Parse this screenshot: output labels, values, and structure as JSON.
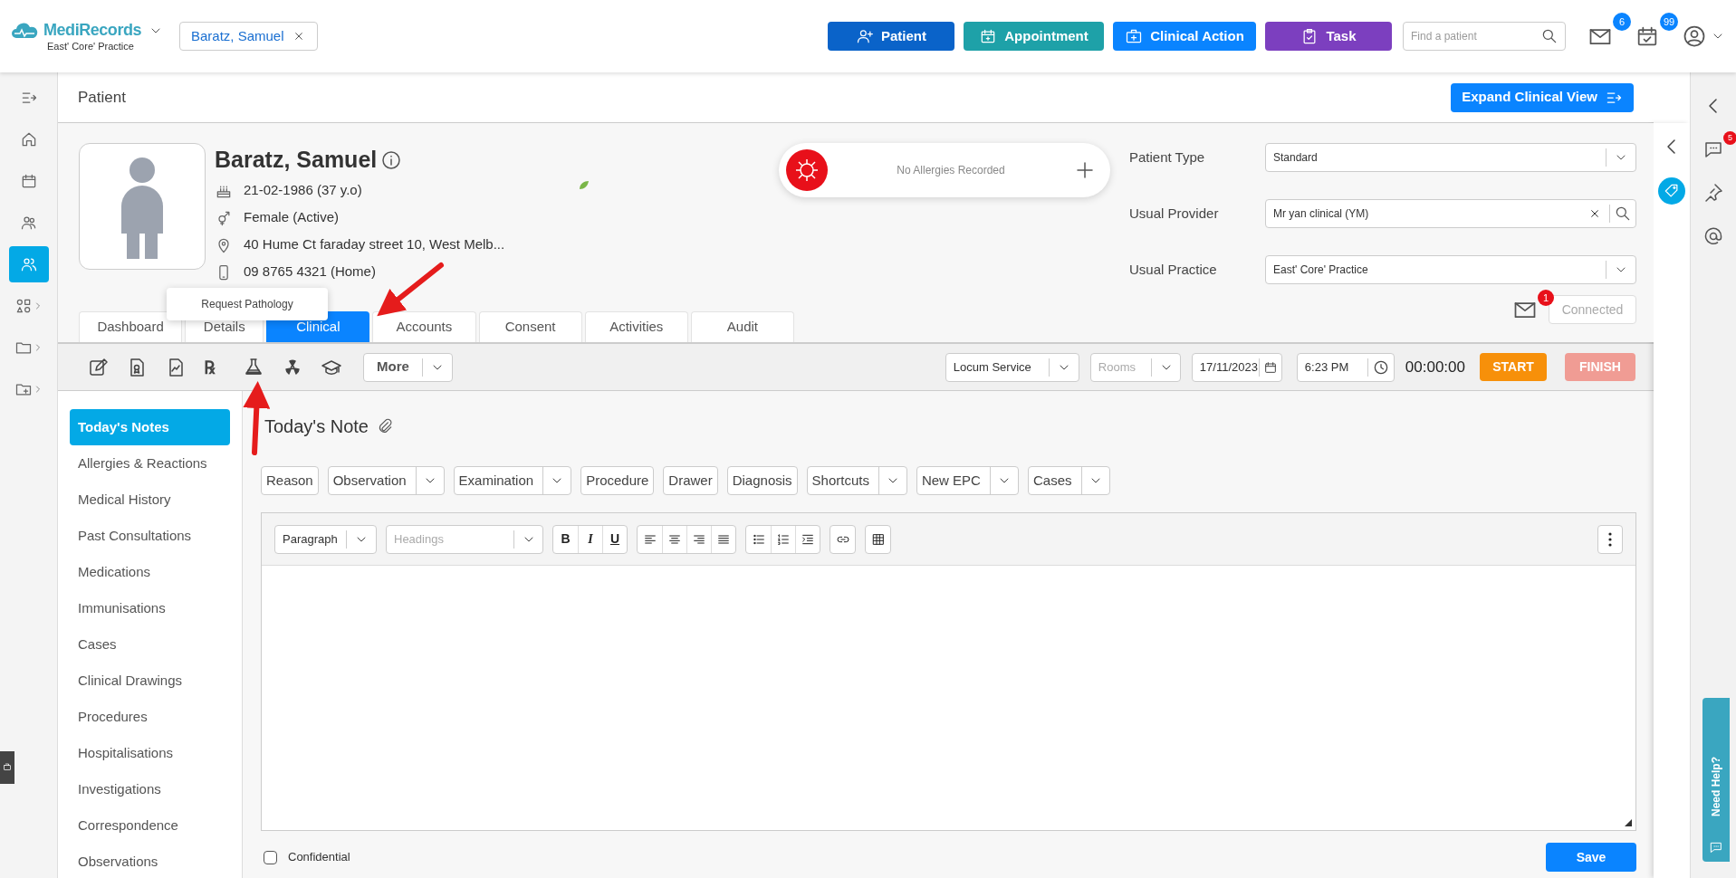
{
  "app": {
    "logo": "MediRecords",
    "practice": "East' Core' Practice"
  },
  "patient_chip": {
    "label": "Baratz, Samuel"
  },
  "action_buttons": [
    {
      "label": "Patient",
      "kind": "patient"
    },
    {
      "label": "Appointment",
      "kind": "appointment"
    },
    {
      "label": "Clinical Action",
      "kind": "clinical"
    },
    {
      "label": "Task",
      "kind": "task"
    }
  ],
  "search": {
    "placeholder": "Find a patient"
  },
  "notifications": [
    {
      "kind": "mail",
      "count": "6"
    },
    {
      "kind": "tasks",
      "count": "99"
    }
  ],
  "rail": [
    {
      "kind": "collapse",
      "selected": false,
      "submenu": false
    },
    {
      "kind": "home",
      "selected": false,
      "submenu": false
    },
    {
      "kind": "calendar",
      "selected": false,
      "submenu": false
    },
    {
      "kind": "people",
      "selected": false,
      "submenu": false
    },
    {
      "kind": "patient",
      "selected": true,
      "submenu": false
    },
    {
      "kind": "apps",
      "selected": false,
      "submenu": true
    },
    {
      "kind": "folder",
      "selected": false,
      "submenu": true
    },
    {
      "kind": "folder-add",
      "selected": false,
      "submenu": true
    }
  ],
  "page_title": "Patient",
  "expand_button": "Expand Clinical View",
  "patient": {
    "name": "Baratz, Samuel",
    "details": [
      {
        "kind": "dob",
        "text": "21-02-1986 (37 y.o)"
      },
      {
        "kind": "gender",
        "text": "Female (Active)"
      },
      {
        "kind": "address",
        "text": "40 Hume Ct faraday street 10, West Melb..."
      },
      {
        "kind": "phone",
        "text": "09 8765 4321 (Home)"
      }
    ]
  },
  "allergies": {
    "text": "No Allergies Recorded"
  },
  "fields": [
    {
      "label": "Patient Type",
      "value": "Standard",
      "kind": "select"
    },
    {
      "label": "Usual Provider",
      "value": "Mr yan clinical (YM)",
      "kind": "search"
    },
    {
      "label": "Usual Practice",
      "value": "East' Core' Practice",
      "kind": "select"
    }
  ],
  "tabs": [
    {
      "label": "Dashboard",
      "selected": false
    },
    {
      "label": "Details",
      "selected": false
    },
    {
      "label": "Clinical",
      "selected": true
    },
    {
      "label": "Accounts",
      "selected": false
    },
    {
      "label": "Consent",
      "selected": false
    },
    {
      "label": "Activities",
      "selected": false
    },
    {
      "label": "Audit",
      "selected": false
    }
  ],
  "messages": {
    "count": "1"
  },
  "connection": {
    "label": "Connected",
    "disabled": true
  },
  "toolbar_icons": [
    {
      "kind": "edit"
    },
    {
      "kind": "certificate"
    },
    {
      "kind": "chart"
    },
    {
      "kind": "rx",
      "glyph": "℞"
    },
    {
      "kind": "flask"
    },
    {
      "kind": "radiation"
    },
    {
      "kind": "education"
    }
  ],
  "more_button": "More",
  "tooltip": "Request Pathology",
  "session": {
    "service": "Locum Service",
    "rooms_placeholder": "Rooms",
    "date": "17/11/2023",
    "time": "6:23 PM",
    "timer": "00:00:00",
    "start": "START",
    "finish": "FINISH",
    "finish_disabled": true
  },
  "menu": [
    {
      "label": "Today's Notes",
      "selected": true
    },
    {
      "label": "Allergies & Reactions",
      "selected": false
    },
    {
      "label": "Medical History",
      "selected": false
    },
    {
      "label": "Past Consultations",
      "selected": false
    },
    {
      "label": "Medications",
      "selected": false
    },
    {
      "label": "Immunisations",
      "selected": false
    },
    {
      "label": "Cases",
      "selected": false
    },
    {
      "label": "Clinical Drawings",
      "selected": false
    },
    {
      "label": "Procedures",
      "selected": false
    },
    {
      "label": "Hospitalisations",
      "selected": false
    },
    {
      "label": "Investigations",
      "selected": false
    },
    {
      "label": "Correspondence",
      "selected": false
    },
    {
      "label": "Observations",
      "selected": false
    }
  ],
  "note": {
    "title": "Today's Note",
    "templates": [
      {
        "label": "Reason",
        "dropdown": false
      },
      {
        "label": "Observation",
        "dropdown": true
      },
      {
        "label": "Examination",
        "dropdown": true
      },
      {
        "label": "Procedure",
        "dropdown": false
      },
      {
        "label": "Drawer",
        "dropdown": false
      },
      {
        "label": "Diagnosis",
        "dropdown": false
      },
      {
        "label": "Shortcuts",
        "dropdown": true
      },
      {
        "label": "New EPC",
        "dropdown": true
      },
      {
        "label": "Cases",
        "dropdown": true
      }
    ],
    "block_format": "Paragraph",
    "headings_placeholder": "Headings",
    "format_groups": [
      [
        {
          "kind": "bold",
          "label": "B"
        },
        {
          "kind": "italic",
          "label": "I"
        },
        {
          "kind": "underline",
          "label": "U"
        }
      ],
      [
        {
          "kind": "align-left"
        },
        {
          "kind": "align-center"
        },
        {
          "kind": "align-right"
        },
        {
          "kind": "justify"
        }
      ],
      [
        {
          "kind": "bullets"
        },
        {
          "kind": "numbers"
        },
        {
          "kind": "indent"
        }
      ],
      [
        {
          "kind": "link"
        }
      ],
      [
        {
          "kind": "table"
        }
      ]
    ],
    "confidential": {
      "label": "Confidential",
      "checked": false
    },
    "save": "Save"
  },
  "side_panel": {
    "chat_badge": "5",
    "help": "Need Help?"
  }
}
